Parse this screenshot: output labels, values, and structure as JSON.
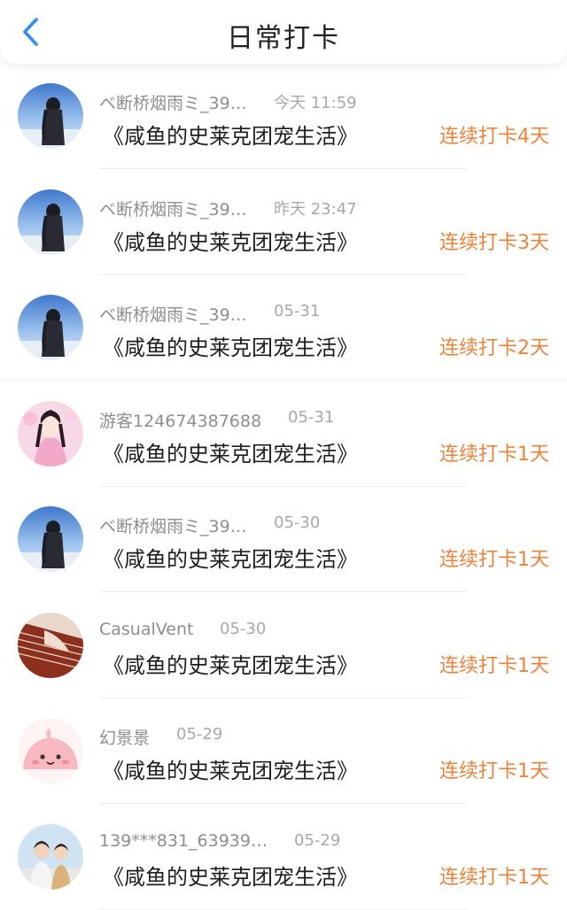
{
  "header": {
    "title": "日常打卡",
    "back_icon": "chevron-left-icon",
    "accent": "#2f8ff0"
  },
  "colors": {
    "streak": "#ee8239"
  },
  "checkins": [
    {
      "user": "ベ断桥烟雨ミ_39…",
      "time": "今天 11:59",
      "book": "《咸鱼的史莱克团宠生活》",
      "streak": "连续打卡4天",
      "avatar": "sky-silhouette"
    },
    {
      "user": "ベ断桥烟雨ミ_39…",
      "time": "昨天 23:47",
      "book": "《咸鱼的史莱克团宠生活》",
      "streak": "连续打卡3天",
      "avatar": "sky-silhouette"
    },
    {
      "user": "ベ断桥烟雨ミ_39…",
      "time": "05-31",
      "book": "《咸鱼的史莱克团宠生活》",
      "streak": "连续打卡2天",
      "avatar": "sky-silhouette"
    },
    {
      "user": "游客124674387688",
      "time": "05-31",
      "book": "《咸鱼的史莱克团宠生活》",
      "streak": "连续打卡1天",
      "avatar": "pink-portrait"
    },
    {
      "user": "ベ断桥烟雨ミ_39…",
      "time": "05-30",
      "book": "《咸鱼的史莱克团宠生活》",
      "streak": "连续打卡1天",
      "avatar": "sky-silhouette"
    },
    {
      "user": "CasualVent",
      "time": "05-30",
      "book": "《咸鱼的史莱克团宠生活》",
      "streak": "连续打卡1天",
      "avatar": "red-guzheng"
    },
    {
      "user": "幻景景",
      "time": "05-29",
      "book": "《咸鱼的史莱克团宠生活》",
      "streak": "连续打卡1天",
      "avatar": "pink-cartoon"
    },
    {
      "user": "139***831_63939…",
      "time": "05-29",
      "book": "《咸鱼的史莱克团宠生活》",
      "streak": "连续打卡1天",
      "avatar": "couple-photo"
    }
  ]
}
